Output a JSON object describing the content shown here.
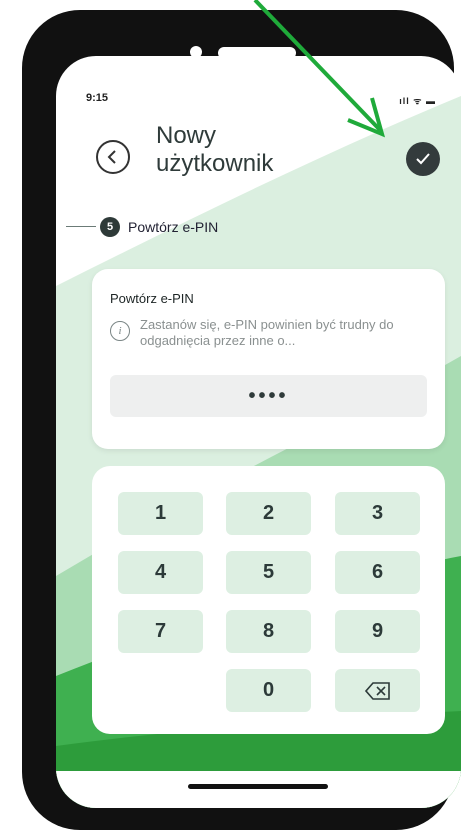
{
  "status_bar": {
    "time": "9:15",
    "icons": "ıll ᯤ ▬"
  },
  "header": {
    "title": "Nowy użytkownik",
    "back_icon": "chevron-left-icon",
    "confirm_icon": "checkmark-icon"
  },
  "step": {
    "number": "5",
    "label": "Powtórz e-PIN"
  },
  "pin_card": {
    "title": "Powtórz e-PIN",
    "info": "Zastanów się, e-PIN powinien być trudny do odgadnięcia przez inne o...",
    "value": "••••"
  },
  "keypad": {
    "k1": "1",
    "k2": "2",
    "k3": "3",
    "k4": "4",
    "k5": "5",
    "k6": "6",
    "k7": "7",
    "k8": "8",
    "k9": "9",
    "k0": "0",
    "backspace_icon": "backspace-icon"
  },
  "colors": {
    "accent_green": "#2faa3c",
    "light_green": "#c9ead2",
    "dark": "#333b3c"
  }
}
